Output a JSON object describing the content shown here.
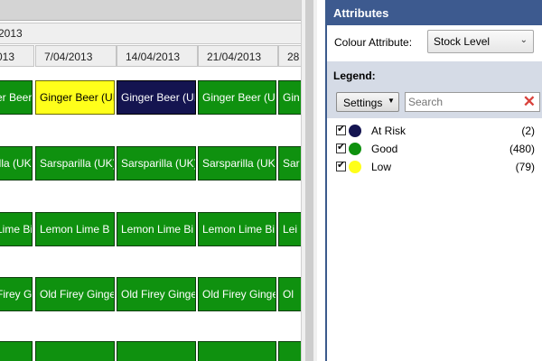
{
  "schedule": {
    "year": "2013",
    "date_headers": [
      "013",
      "7/04/2013",
      "14/04/2013",
      "21/04/2013",
      "28"
    ],
    "rows": [
      {
        "cells": [
          {
            "text": "er Beer (UI",
            "color": "green"
          },
          {
            "text": "Ginger Beer (UI",
            "color": "yellow"
          },
          {
            "text": "Ginger Beer (UI",
            "color": "navy"
          },
          {
            "text": "Ginger Beer (UI",
            "color": "green"
          },
          {
            "text": "Gin",
            "color": "green"
          }
        ]
      },
      {
        "cells": [
          {
            "text": "illa (UK)",
            "color": "green"
          },
          {
            "text": "Sarsparilla (UK)",
            "color": "green"
          },
          {
            "text": "Sarsparilla (UK)",
            "color": "green"
          },
          {
            "text": "Sarsparilla (UK)",
            "color": "green"
          },
          {
            "text": "Sar",
            "color": "green"
          }
        ]
      },
      {
        "cells": [
          {
            "text": "Lime Bi",
            "color": "green"
          },
          {
            "text": "Lemon Lime B",
            "color": "green"
          },
          {
            "text": "Lemon Lime Bi",
            "color": "green"
          },
          {
            "text": "Lemon Lime Bi",
            "color": "green"
          },
          {
            "text": "Lei",
            "color": "green"
          }
        ]
      },
      {
        "cells": [
          {
            "text": "Firey Ginge",
            "color": "green"
          },
          {
            "text": "Old Firey Ginge",
            "color": "green"
          },
          {
            "text": "Old Firey Ginge",
            "color": "green"
          },
          {
            "text": "Old Firey Ginge",
            "color": "green"
          },
          {
            "text": "Ol",
            "color": "green"
          }
        ]
      },
      {
        "cells": [
          {
            "text": "",
            "color": "green"
          },
          {
            "text": "",
            "color": "green"
          },
          {
            "text": "",
            "color": "green"
          },
          {
            "text": "",
            "color": "green"
          },
          {
            "text": "",
            "color": "green"
          }
        ]
      }
    ]
  },
  "attributes": {
    "title": "Attributes",
    "colour_label": "Colour Attribute:",
    "colour_value": "Stock Level",
    "legend_title": "Legend:",
    "settings_label": "Settings",
    "search_placeholder": "Search",
    "items": [
      {
        "name": "At Risk",
        "count": "(2)",
        "color": "#141450",
        "checked": true
      },
      {
        "name": "Good",
        "count": "(480)",
        "color": "#0f910f",
        "checked": true
      },
      {
        "name": "Low",
        "count": "(79)",
        "color": "#ffff1a",
        "checked": true
      }
    ]
  },
  "colors": {
    "green": "#0f910f",
    "yellow": "#ffff1a",
    "navy": "#141450",
    "panel_header": "#3d5a8f"
  }
}
